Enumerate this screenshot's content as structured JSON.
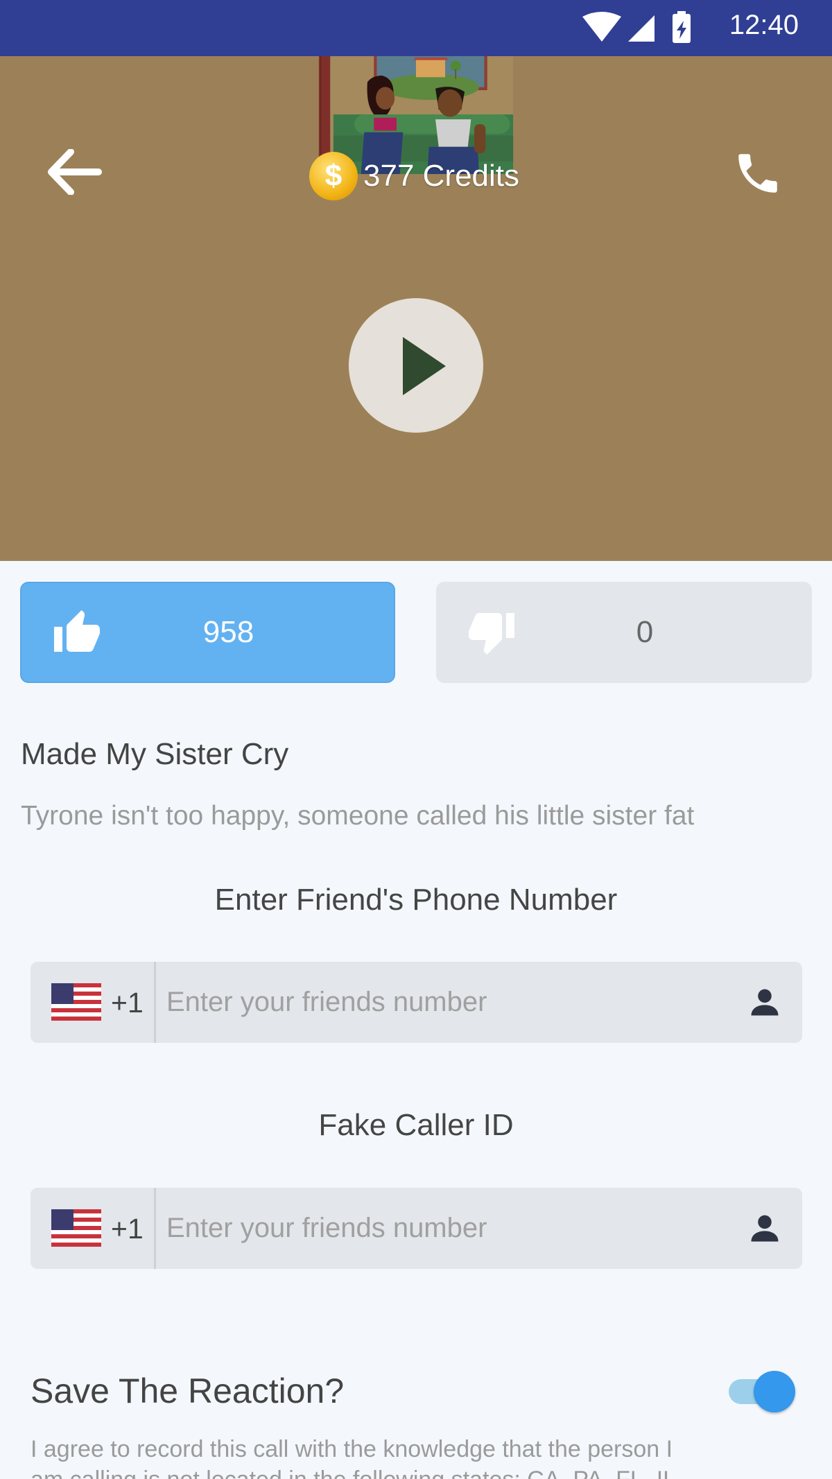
{
  "status_bar": {
    "time": "12:40"
  },
  "header": {
    "credits": "377 Credits",
    "coin_symbol": "$"
  },
  "votes": {
    "likes": "958",
    "dislikes": "0"
  },
  "prank": {
    "title": "Made My Sister Cry",
    "description": "Tyrone isn't too happy, someone called his little sister fat"
  },
  "friend_phone": {
    "label": "Enter Friend's Phone Number",
    "prefix": "+1",
    "placeholder": "Enter your friends number"
  },
  "caller_id": {
    "label": "Fake Caller ID",
    "prefix": "+1",
    "placeholder": "Enter your friends number"
  },
  "save_reaction": {
    "label": "Save The Reaction?",
    "enabled": true,
    "agreement": "I agree to record this call with the knowledge that the person I am calling is not located in the following states: CA, PA, FL, IL"
  },
  "colors": {
    "status_bar": "#303f94",
    "like_button": "#62b2f2",
    "toggle_accent": "#3498ec"
  },
  "icons": [
    "wifi-icon",
    "signal-icon",
    "battery-icon",
    "back-arrow-icon",
    "coin-icon",
    "phone-icon",
    "play-icon",
    "thumbs-up-icon",
    "thumbs-down-icon",
    "us-flag-icon",
    "contact-icon"
  ]
}
